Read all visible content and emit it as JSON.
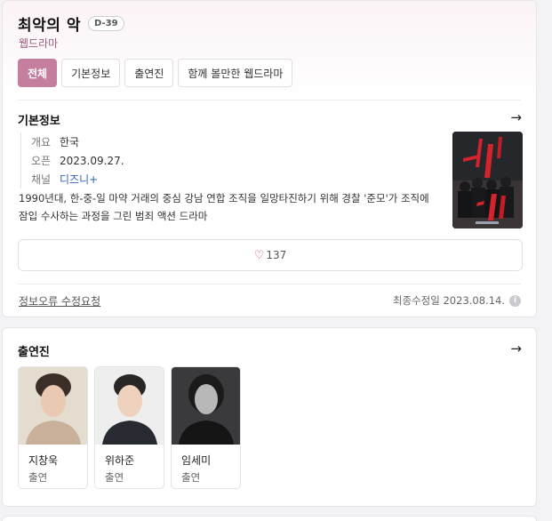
{
  "drama": {
    "title": "최악의 악",
    "dday": "D-39",
    "genre": "웹드라마"
  },
  "tabs": [
    {
      "label": "전체",
      "active": true
    },
    {
      "label": "기본정보",
      "active": false
    },
    {
      "label": "출연진",
      "active": false
    },
    {
      "label": "함께 볼만한 웹드라마",
      "active": false
    }
  ],
  "basic_info": {
    "section_title": "기본정보",
    "rows": [
      {
        "key": "개요",
        "value": "한국"
      },
      {
        "key": "오픈",
        "value": "2023.09.27."
      },
      {
        "key": "채널",
        "value": "디즈니+"
      }
    ],
    "description": "1990년대, 한-중-일 마약 거래의 중심 강남 연합 조직을 일망타진하기 위해 경찰 '준모'가 조직에 잠입 수사하는 과정을 그린 범죄 액션 드라마",
    "like_count": "137",
    "report_link": "정보오류 수정요청",
    "last_updated": "최종수정일 2023.08.14."
  },
  "cast": {
    "section_title": "출연진",
    "members": [
      {
        "name": "지창욱",
        "role": "출연"
      },
      {
        "name": "위하준",
        "role": "출연"
      },
      {
        "name": "임세미",
        "role": "출연"
      }
    ]
  },
  "icons": {
    "arrow": "arrow-right-icon",
    "heart": "heart-outline-icon",
    "info": "info-circle-icon"
  },
  "colors": {
    "accent": "#c47f9f",
    "genre_text": "#9a5c7e",
    "link": "#2f5fbf",
    "heart": "#d04a5e"
  }
}
